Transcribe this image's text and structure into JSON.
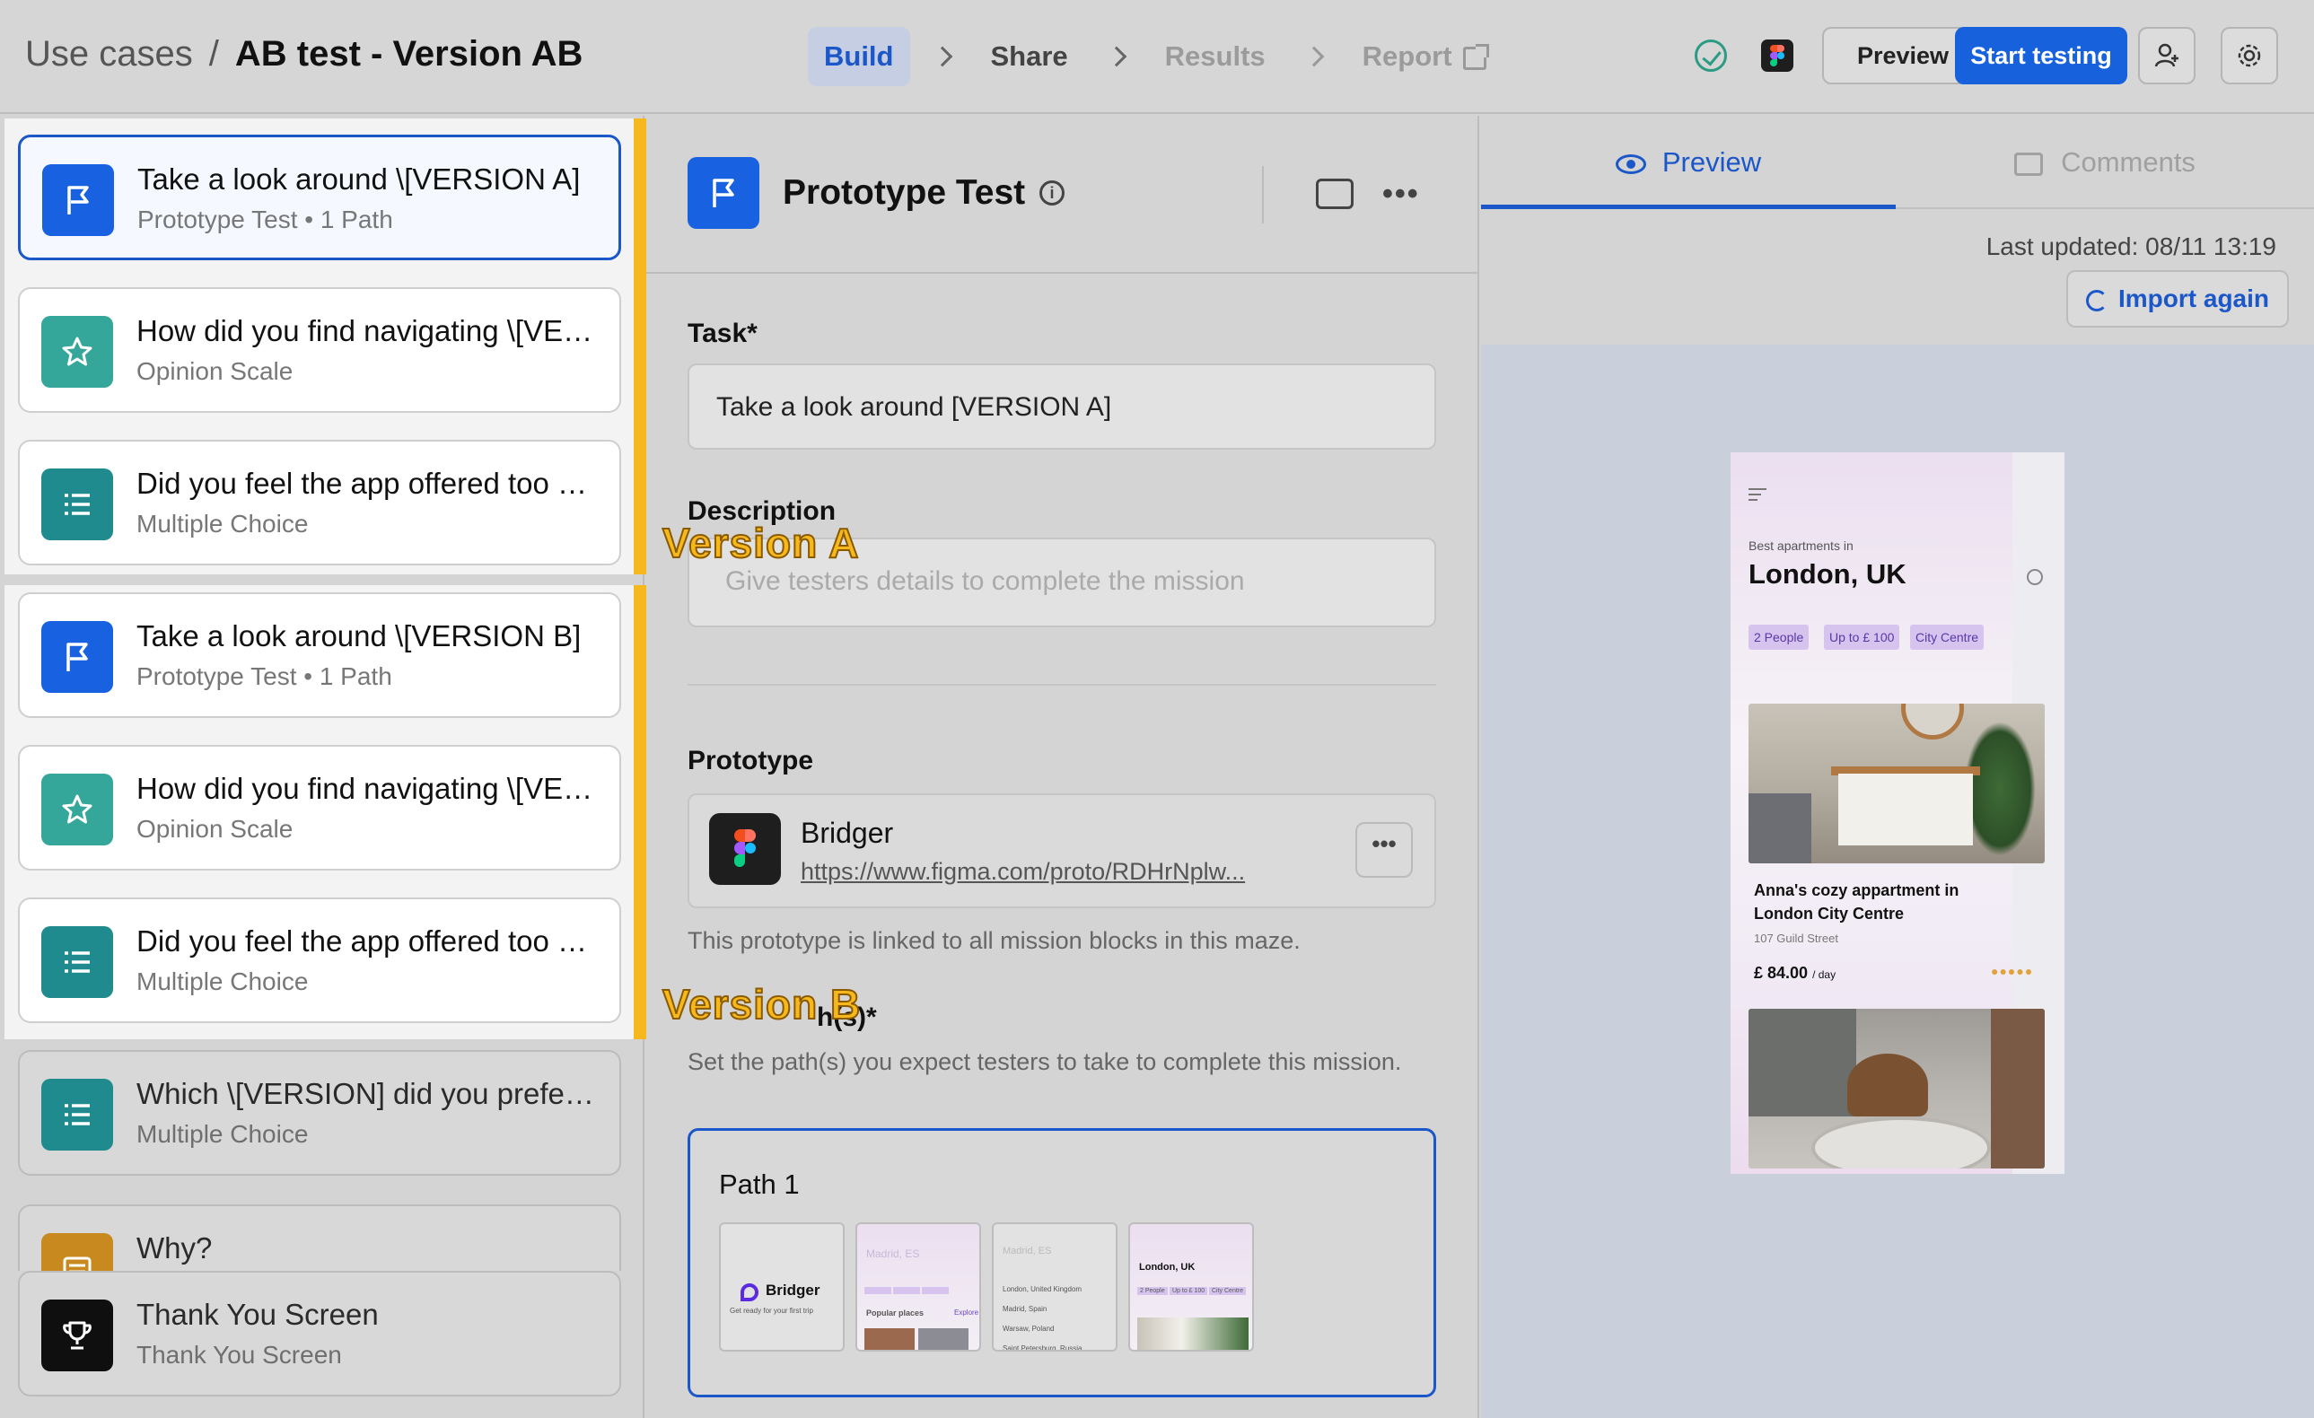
{
  "breadcrumb": {
    "section": "Use cases",
    "separator": "/",
    "title": "AB test - Version AB"
  },
  "steps": [
    {
      "label": "Build",
      "state": "active"
    },
    {
      "label": "Share",
      "state": "done"
    },
    {
      "label": "Results",
      "state": "disabled"
    },
    {
      "label": "Report",
      "state": "disabled"
    }
  ],
  "toolbar": {
    "status_icon": "check-circle-icon",
    "figma_icon": "figma-icon",
    "preview_label": "Preview",
    "start_label": "Start testing",
    "user_icon": "add-user-icon",
    "settings_icon": "gear-icon"
  },
  "blocks": [
    {
      "title": "Take a look around \\[VERSION A]",
      "subtitle": "Prototype Test • 1 Path",
      "icon": "flag-icon",
      "color": "#1861e0",
      "selected": true,
      "group": "A"
    },
    {
      "title": "How did you find navigating \\[VE…",
      "subtitle": "Opinion Scale",
      "icon": "star-icon",
      "color": "#34a69a",
      "group": "A"
    },
    {
      "title": "Did you feel the app offered too …",
      "subtitle": "Multiple Choice",
      "icon": "list-icon",
      "color": "#1f8b8e",
      "group": "A"
    },
    {
      "title": "Take a look around \\[VERSION B]",
      "subtitle": "Prototype Test • 1 Path",
      "icon": "flag-icon",
      "color": "#1861e0",
      "group": "B"
    },
    {
      "title": "How did you find navigating \\[VE…",
      "subtitle": "Opinion Scale",
      "icon": "star-icon",
      "color": "#34a69a",
      "group": "B"
    },
    {
      "title": "Did you feel the app offered too …",
      "subtitle": "Multiple Choice",
      "icon": "list-icon",
      "color": "#1f8b8e",
      "group": "B"
    },
    {
      "title": "Which \\[VERSION] did you prefe…",
      "subtitle": "Multiple Choice",
      "icon": "list-icon",
      "color": "#1f8b8e"
    },
    {
      "title": "Why?",
      "subtitle": "",
      "icon": "text-icon",
      "color": "#c88a1f"
    },
    {
      "title": "Thank You Screen",
      "subtitle": "Thank You Screen",
      "icon": "trophy-icon",
      "color": "#0f0f0f"
    }
  ],
  "annotations": {
    "version_a": "Version A",
    "version_b": "Version B"
  },
  "editor": {
    "block_title": "Prototype Test",
    "task_label": "Task*",
    "task_value": "Take a look around [VERSION A]",
    "description_label": "Description",
    "description_placeholder": "Give testers details to complete the mission",
    "prototype_label": "Prototype",
    "prototype_name": "Bridger",
    "prototype_url": "https://www.figma.com/proto/RDHrNplw...",
    "prototype_note": "This prototype is linked to all mission blocks in this maze.",
    "paths_label": "Expected path(s)*",
    "paths_label_visible": "h(s)*",
    "paths_help": "Set the path(s) you expect testers to take to complete this mission.",
    "path_title": "Path 1",
    "thumbs": [
      {
        "brand": "Bridger",
        "caption": "Get ready for your first trip"
      },
      {
        "city": "Madrid, ES",
        "section": "Popular places",
        "action": "Explore"
      },
      {
        "city": "Madrid, ES",
        "items": [
          "London, United Kingdom",
          "Madrid, Spain",
          "Warsaw, Poland",
          "Saint Petersburg, Russia"
        ]
      },
      {
        "city": "London, UK",
        "chips": [
          "2 People",
          "Up to £ 100",
          "City Centre"
        ]
      }
    ]
  },
  "preview_panel": {
    "tabs": [
      {
        "label": "Preview",
        "active": true
      },
      {
        "label": "Comments",
        "active": false
      }
    ],
    "last_updated": "Last updated: 08/11 13:19",
    "import_label": "Import again",
    "phone": {
      "small_label": "Best apartments in",
      "city": "London, UK",
      "chips": [
        "2 People",
        "Up to £ 100",
        "City Centre"
      ],
      "listing_title_1": "Anna's cozy appartment in",
      "listing_title_2": "London City Centre",
      "address": "107 Guild Street",
      "price": "£ 84.00",
      "price_unit": "/ day",
      "rating": 5
    }
  }
}
